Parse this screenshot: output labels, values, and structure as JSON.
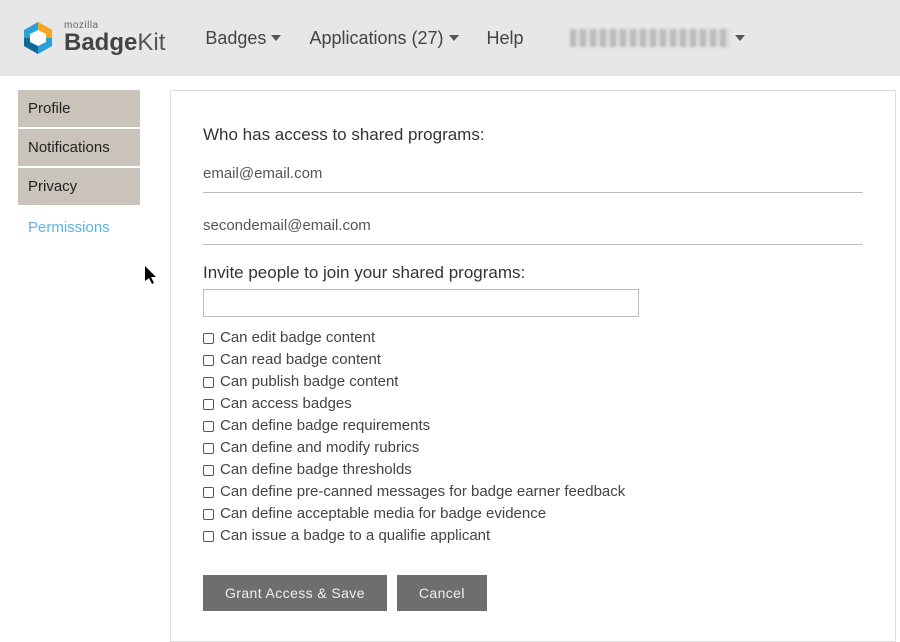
{
  "brand": {
    "small": "mozilla",
    "name_bold": "Badge",
    "name_light": "Kit"
  },
  "nav": {
    "badges": "Badges",
    "applications": "Applications (27)",
    "help": "Help"
  },
  "sidebar": {
    "items": [
      {
        "label": "Profile"
      },
      {
        "label": "Notifications"
      },
      {
        "label": "Privacy"
      },
      {
        "label": "Permissions"
      }
    ]
  },
  "panel": {
    "access_label": "Who has access to shared programs:",
    "emails": [
      "email@email.com",
      "secondemail@email.com"
    ],
    "invite_label": "Invite people to join your shared programs:",
    "invite_value": "",
    "permissions": [
      "Can edit badge content",
      "Can read badge content",
      "Can publish badge content",
      "Can access badges",
      "Can define badge requirements",
      "Can define and modify rubrics",
      "Can define badge thresholds",
      "Can define pre-canned messages for badge earner feedback",
      "Can define acceptable media for badge evidence",
      "Can issue a badge to a qualifie applicant"
    ],
    "grant_btn": "Grant Access & Save",
    "cancel_btn": "Cancel"
  }
}
